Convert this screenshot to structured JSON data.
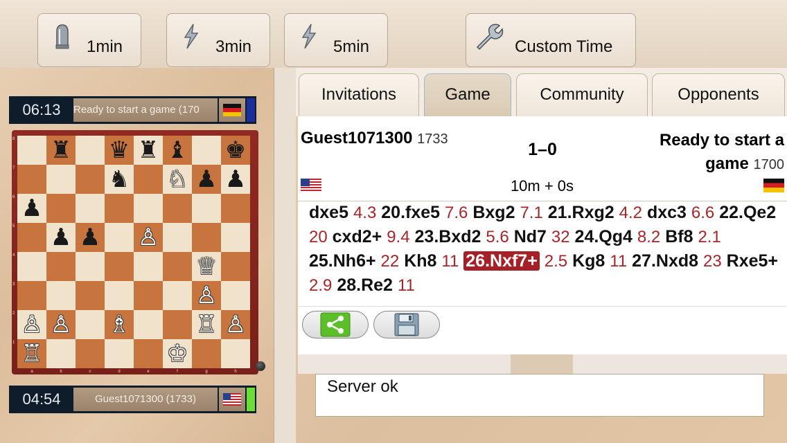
{
  "toolbar": {
    "buttons": [
      {
        "label": "1min",
        "icon": "bullet-icon"
      },
      {
        "label": "3min",
        "icon": "lightning-icon"
      },
      {
        "label": "5min",
        "icon": "lightning-icon"
      },
      {
        "label": "Custom Time",
        "icon": "wrench-icon"
      }
    ]
  },
  "top_player": {
    "clock": "06:13",
    "name": "Ready to start a game (170",
    "flag": "germany-flag",
    "turn_color": "#1b2f9a"
  },
  "bottom_player": {
    "clock": "04:54",
    "name": "Guest1071300 (1733)",
    "flag": "usa-flag",
    "turn_color": "#6cde3a"
  },
  "board": {
    "ranks": [
      "8",
      "7",
      "6",
      "5",
      "4",
      "3",
      "2",
      "1"
    ],
    "files": [
      "a",
      "b",
      "c",
      "d",
      "e",
      "f",
      "g",
      "h"
    ],
    "position": [
      [
        "",
        "b:♜",
        "",
        "b:♛",
        "b:♜",
        "b:♝",
        "",
        "b:♚"
      ],
      [
        "",
        "",
        "",
        "b:♞",
        "",
        "w:♘",
        "b:♟",
        "b:♟"
      ],
      [
        "b:♟",
        "",
        "",
        "",
        "",
        "",
        "",
        ""
      ],
      [
        "",
        "b:♟",
        "b:♟",
        "",
        "w:♙",
        "",
        "",
        ""
      ],
      [
        "",
        "",
        "",
        "",
        "",
        "",
        "w:♕",
        ""
      ],
      [
        "",
        "",
        "",
        "",
        "",
        "",
        "w:♙",
        ""
      ],
      [
        "w:♙",
        "w:♙",
        "",
        "w:♗",
        "",
        "",
        "w:♖",
        "w:♙"
      ],
      [
        "w:♖",
        "",
        "",
        "",
        "",
        "w:♔",
        "",
        ""
      ]
    ]
  },
  "tabs": [
    "Invitations",
    "Game",
    "Community",
    "Opponents"
  ],
  "game": {
    "white_name": "Guest1071300",
    "white_rating": "1733",
    "result": "1–0",
    "black_name_1": "Ready to start a",
    "black_name_2": "game",
    "black_rating": "1700",
    "time_control": "10m + 0s"
  },
  "moves": [
    {
      "m": "dxe5",
      "t": "4.3"
    },
    {
      "m": "20.fxe5",
      "t": "7.6"
    },
    {
      "m": "Bxg2",
      "t": "7.1"
    },
    {
      "m": "21.Rxg2",
      "t": "4.2"
    },
    {
      "m": "dxc3",
      "t": "6.6"
    },
    {
      "m": "22.Qe2",
      "t": "20"
    },
    {
      "m": "cxd2+",
      "t": "9.4"
    },
    {
      "m": "23.Bxd2",
      "t": "5.6"
    },
    {
      "m": "Nd7",
      "t": "32"
    },
    {
      "m": "24.Qg4",
      "t": "8.2"
    },
    {
      "m": "Bf8",
      "t": "2.1"
    },
    {
      "m": "25.Nh6+",
      "t": "22"
    },
    {
      "m": "Kh8",
      "t": "11"
    },
    {
      "m": "26.Nxf7+",
      "t": "2.5",
      "current": true
    },
    {
      "m": "Kg8",
      "t": "11"
    },
    {
      "m": "27.Nxd8",
      "t": "23"
    },
    {
      "m": "Rxe5+",
      "t": "2.9"
    },
    {
      "m": "28.Re2",
      "t": "11"
    }
  ],
  "status": "Server ok"
}
